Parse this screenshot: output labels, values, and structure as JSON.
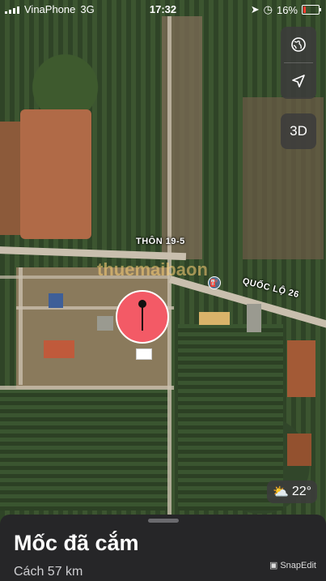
{
  "status_bar": {
    "carrier": "VinaPhone",
    "network": "3G",
    "time": "17:32",
    "battery_percent": "16%",
    "battery_color": "#ff3b30"
  },
  "map_controls": {
    "globe_icon": "globe-icon",
    "location_icon": "location-arrow-icon",
    "view_3d_label": "3D"
  },
  "map_labels": {
    "village": "THÔN 19-5",
    "highway": "QUỐC LỘ 26",
    "watermark": "thuemaibaon"
  },
  "weather": {
    "icon": "partly-cloudy-icon",
    "temperature": "22°"
  },
  "sheet": {
    "title": "Mốc đã cắm",
    "subtitle": "Cách 57 km",
    "watermark_label": "SnapEdit"
  },
  "colors": {
    "pin": "#f35a66",
    "sheet_bg": "#262628"
  }
}
